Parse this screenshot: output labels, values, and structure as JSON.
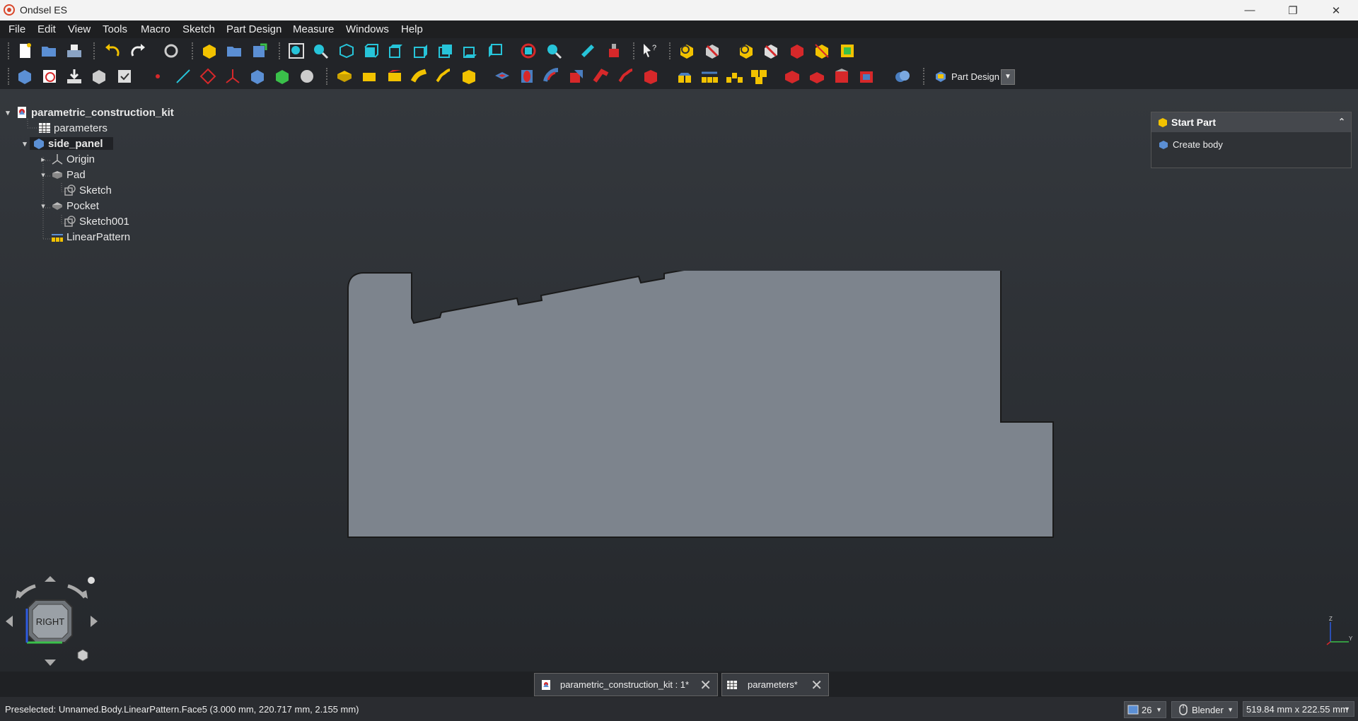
{
  "window": {
    "title": "Ondsel ES"
  },
  "menu": [
    "File",
    "Edit",
    "View",
    "Tools",
    "Macro",
    "Sketch",
    "Part Design",
    "Measure",
    "Windows",
    "Help"
  ],
  "workbench": {
    "label": "Part Design"
  },
  "tree": {
    "root": "parametric_construction_kit",
    "parameters": "parameters",
    "body": "side_panel",
    "origin": "Origin",
    "pad": "Pad",
    "sketch": "Sketch",
    "pocket": "Pocket",
    "sketch001": "Sketch001",
    "linear_pattern": "LinearPattern"
  },
  "task_panel": {
    "title": "Start Part",
    "action": "Create body"
  },
  "navcube": {
    "face": "RIGHT"
  },
  "axis": {
    "z": "Z",
    "y": "Y"
  },
  "tabs": [
    {
      "label": "parametric_construction_kit : 1*"
    },
    {
      "label": "parameters*"
    }
  ],
  "status": {
    "preselected": "Preselected: Unnamed.Body.LinearPattern.Face5 (3.000 mm, 220.717 mm, 2.155 mm)",
    "counter": "26",
    "navstyle": "Blender",
    "dimensions": "519.84 mm x 222.55 mm"
  },
  "colors": {
    "accent": "#d9472b",
    "shape_fill": "#7d848d",
    "cyan": "#27c4d9",
    "yellow": "#f2c200",
    "red": "#d6282a"
  }
}
